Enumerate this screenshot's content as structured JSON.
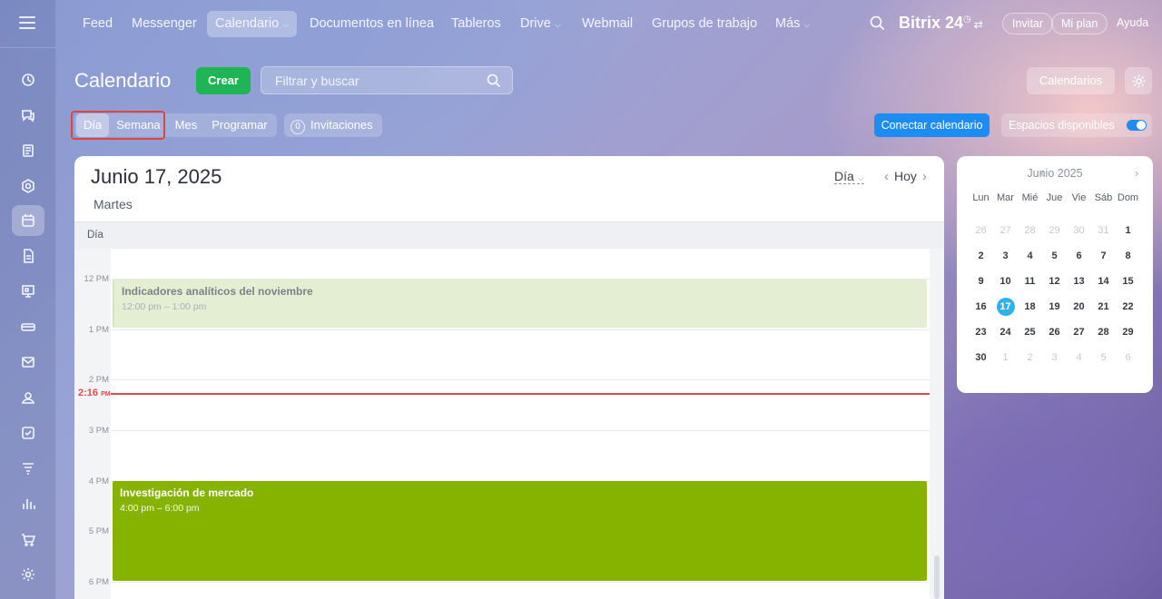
{
  "colors": {
    "create": "#1fb455",
    "connect": "#1d8cf3",
    "now": "#e14b47",
    "today": "#2fb2ec",
    "event_green": "#85b300",
    "event_faded": "#e4eed3"
  },
  "sidebar": {
    "icons": [
      "menu-icon",
      "activity-icon",
      "chat-icon",
      "feed-icon",
      "hub-icon",
      "calendar-icon",
      "document-icon",
      "board-icon",
      "drive-icon",
      "mail-icon",
      "groups-icon",
      "tasks-icon",
      "crm-icon",
      "analytics-icon",
      "shop-icon",
      "settings-icon"
    ]
  },
  "topnav": {
    "items": [
      "Feed",
      "Messenger",
      "Calendario",
      "Documentos en línea",
      "Tableros",
      "Drive",
      "Webmail",
      "Grupos de trabajo",
      "Más"
    ],
    "brand": "Bitrix 24",
    "invite": "Invitar",
    "my_plan": "Mi plan",
    "help": "Ayuda"
  },
  "header": {
    "title": "Calendario",
    "create": "Crear",
    "search_placeholder": "Filtrar y buscar",
    "calendars": "Calendarios"
  },
  "views": {
    "items": [
      "Día",
      "Semana",
      "Mes",
      "Programar"
    ],
    "selected": "Día",
    "invitations_count": "0",
    "invitations": "Invitaciones",
    "connect": "Conectar calendario",
    "slots": "Espacios disponibles"
  },
  "day_view": {
    "date": "Junio 17, 2025",
    "weekday": "Martes",
    "view_select": "Día",
    "today": "Hoy",
    "strip_label": "Día",
    "hours": [
      "12 PM",
      "1 PM",
      "2 PM",
      "3 PM",
      "4 PM",
      "5 PM",
      "6 PM"
    ],
    "now": "2:16",
    "now_suffix": "PM",
    "events": [
      {
        "title": "Indicadores analíticos del noviembre",
        "time": "12:00 pm – 1:00 pm"
      },
      {
        "title": "Investigación de mercado",
        "time": "4:00 pm – 6:00 pm"
      }
    ]
  },
  "mini_calendar": {
    "month": "Junio 2025",
    "dow": [
      "Lun",
      "Mar",
      "Mié",
      "Jue",
      "Vie",
      "Sáb",
      "Dom"
    ],
    "weeks": [
      [
        "26",
        "27",
        "28",
        "29",
        "30",
        "31",
        "1"
      ],
      [
        "2",
        "3",
        "4",
        "5",
        "6",
        "7",
        "8"
      ],
      [
        "9",
        "10",
        "11",
        "12",
        "13",
        "14",
        "15"
      ],
      [
        "16",
        "17",
        "18",
        "19",
        "20",
        "21",
        "22"
      ],
      [
        "23",
        "24",
        "25",
        "26",
        "27",
        "28",
        "29"
      ],
      [
        "30",
        "1",
        "2",
        "3",
        "4",
        "5",
        "6"
      ]
    ],
    "today": "17"
  }
}
